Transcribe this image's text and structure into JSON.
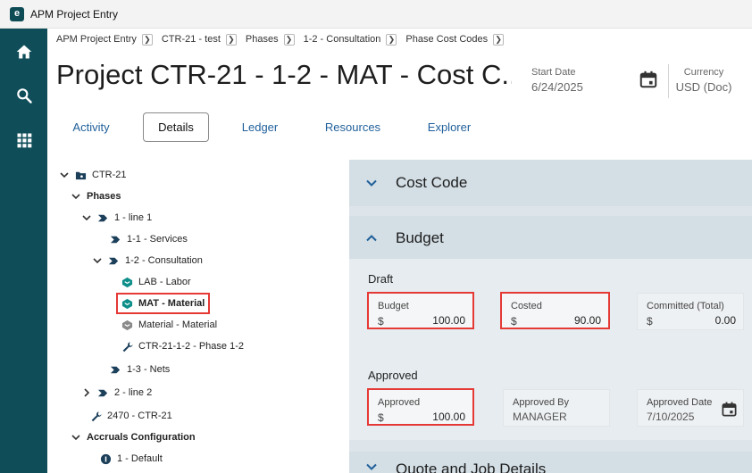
{
  "window": {
    "logo_letter": "e",
    "title": "APM Project Entry"
  },
  "nav_rail": {
    "items": [
      "home-icon",
      "search-icon",
      "apps-grid-icon"
    ]
  },
  "breadcrumbs": [
    {
      "label": "APM Project Entry"
    },
    {
      "label": "CTR-21 - test"
    },
    {
      "label": "Phases"
    },
    {
      "label": "1-2 - Consultation"
    },
    {
      "label": "Phase Cost Codes"
    }
  ],
  "header": {
    "title": "Project CTR-21 - 1-2 - MAT - Cost C...",
    "start_date_label": "Start Date",
    "start_date_value": "6/24/2025",
    "currency_label": "Currency",
    "currency_value": "USD (Doc)"
  },
  "tabs": [
    {
      "label": "Activity",
      "active": false
    },
    {
      "label": "Details",
      "active": true
    },
    {
      "label": "Ledger",
      "active": false
    },
    {
      "label": "Resources",
      "active": false
    },
    {
      "label": "Explorer",
      "active": false
    }
  ],
  "tree": [
    {
      "label": "CTR-21",
      "icon": "folder-icon",
      "expanded": true,
      "selected": false
    },
    {
      "label": "Phases",
      "icon": "",
      "expanded": true,
      "selected": false
    },
    {
      "label": "1 - line 1",
      "icon": "phase-icon",
      "expanded": true,
      "selected": false
    },
    {
      "label": "1-1 - Services",
      "icon": "phase-icon",
      "selected": false
    },
    {
      "label": "1-2 - Consultation",
      "icon": "phase-icon",
      "expanded": true,
      "selected": false
    },
    {
      "label": "LAB - Labor",
      "icon": "cost-code-icon",
      "selected": false
    },
    {
      "label": "MAT - Material",
      "icon": "cost-code-icon",
      "selected": true
    },
    {
      "label": "Material - Material",
      "icon": "cost-code-grey-icon",
      "selected": false
    },
    {
      "label": "CTR-21-1-2 - Phase 1-2",
      "icon": "wrench-icon",
      "selected": false
    },
    {
      "label": "1-3 - Nets",
      "icon": "phase-icon",
      "selected": false
    },
    {
      "label": "2 - line 2",
      "icon": "phase-icon",
      "expanded": false,
      "selected": false
    },
    {
      "label": "2470 - CTR-21",
      "icon": "wrench-icon",
      "selected": false
    },
    {
      "label": "Accruals Configuration",
      "icon": "",
      "expanded": true,
      "selected": false
    },
    {
      "label": "1 - Default",
      "icon": "accrual-icon",
      "selected": false
    }
  ],
  "sections": {
    "cost_code": {
      "title": "Cost Code",
      "expanded": false
    },
    "budget": {
      "title": "Budget",
      "expanded": true
    },
    "quote": {
      "title": "Quote and Job Details",
      "expanded": false
    }
  },
  "budget": {
    "draft_label": "Draft",
    "approved_label": "Approved",
    "fields": {
      "budget": {
        "label": "Budget",
        "currency": "$",
        "value": "100.00"
      },
      "costed": {
        "label": "Costed",
        "currency": "$",
        "value": "90.00"
      },
      "committed": {
        "label": "Committed (Total)",
        "currency": "$",
        "value": "0.00"
      },
      "approved": {
        "label": "Approved",
        "currency": "$",
        "value": "100.00"
      },
      "approved_by": {
        "label": "Approved By",
        "value": "MANAGER"
      },
      "approved_date": {
        "label": "Approved Date",
        "value": "7/10/2025"
      }
    }
  },
  "colors": {
    "rail": "#0f4e59",
    "accent": "#1f5f9a",
    "highlight": "#e53935",
    "icon_teal": "#0e8f8a"
  }
}
